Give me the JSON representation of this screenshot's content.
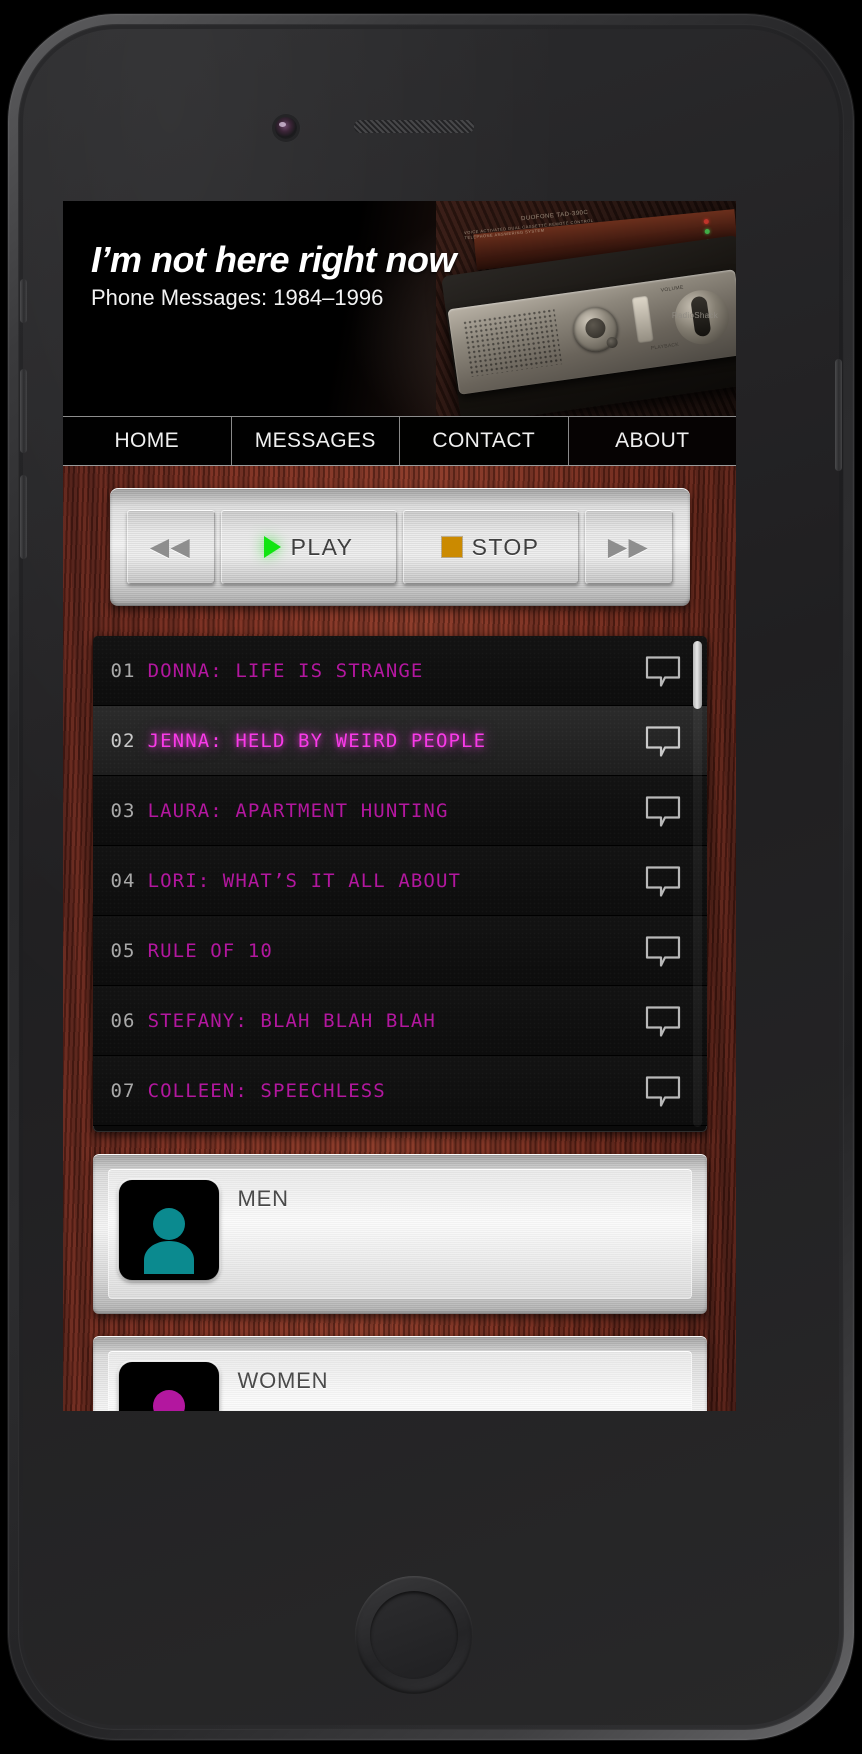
{
  "device": {
    "earpiece_icon": "speaker-grille",
    "camera_icon": "front-camera",
    "home_button_icon": "home-button"
  },
  "site": {
    "title": "I’m not here right now",
    "subtitle": "Phone Messages: 1984–1996",
    "hero_image_alt": "vintage answering machine on wood desk",
    "hero_machine_brand": "DUOFONE TAD-390C",
    "hero_machine_sub": "VOICE ACTIVATED DUAL CASSETTE REMOTE CONTROL TELEPHONE ANSWERING SYSTEM",
    "hero_side_text": "RadioShack"
  },
  "nav": {
    "items": [
      {
        "label": "HOME",
        "id": "home",
        "active": true
      },
      {
        "label": "MESSAGES",
        "id": "messages",
        "active": false
      },
      {
        "label": "CONTACT",
        "id": "contact",
        "active": false
      },
      {
        "label": "ABOUT",
        "id": "about",
        "active": false
      }
    ]
  },
  "transport": {
    "rewind": {
      "label": "",
      "icon": "rewind-icon",
      "glyph": "◀◀"
    },
    "play": {
      "label": "PLAY",
      "icon": "play-icon",
      "color": "#12e512"
    },
    "stop": {
      "label": "STOP",
      "icon": "stop-icon",
      "color": "#cb8a00"
    },
    "forward": {
      "label": "",
      "icon": "fast-forward-icon",
      "glyph": "▶▶"
    }
  },
  "messages": {
    "scroll_position": "top",
    "items": [
      {
        "num": "01",
        "title": "DONNA: LIFE IS STRANGE",
        "active": false,
        "icon": "speech-bubble-icon"
      },
      {
        "num": "02",
        "title": "JENNA: HELD BY WEIRD PEOPLE",
        "active": true,
        "icon": "speech-bubble-icon"
      },
      {
        "num": "03",
        "title": "LAURA: APARTMENT HUNTING",
        "active": false,
        "icon": "speech-bubble-icon"
      },
      {
        "num": "04",
        "title": "LORI: WHAT’S IT ALL ABOUT",
        "active": false,
        "icon": "speech-bubble-icon"
      },
      {
        "num": "05",
        "title": "RULE OF 10",
        "active": false,
        "icon": "speech-bubble-icon"
      },
      {
        "num": "06",
        "title": "STEFANY: BLAH BLAH BLAH",
        "active": false,
        "icon": "speech-bubble-icon"
      },
      {
        "num": "07",
        "title": "COLLEEN: SPEECHLESS",
        "active": false,
        "icon": "speech-bubble-icon"
      }
    ]
  },
  "categories": [
    {
      "label": "MEN",
      "icon": "person-avatar-icon",
      "color": "#0b8a8f"
    },
    {
      "label": "WOMEN",
      "icon": "person-avatar-icon",
      "color": "#b3179f"
    }
  ],
  "colors": {
    "accent_magenta": "#b3179f",
    "accent_magenta_active": "#f93ae8",
    "play_green": "#12e512",
    "stop_amber": "#cb8a00",
    "avatar_teal": "#0b8a8f",
    "wood": "#8e3a27"
  }
}
